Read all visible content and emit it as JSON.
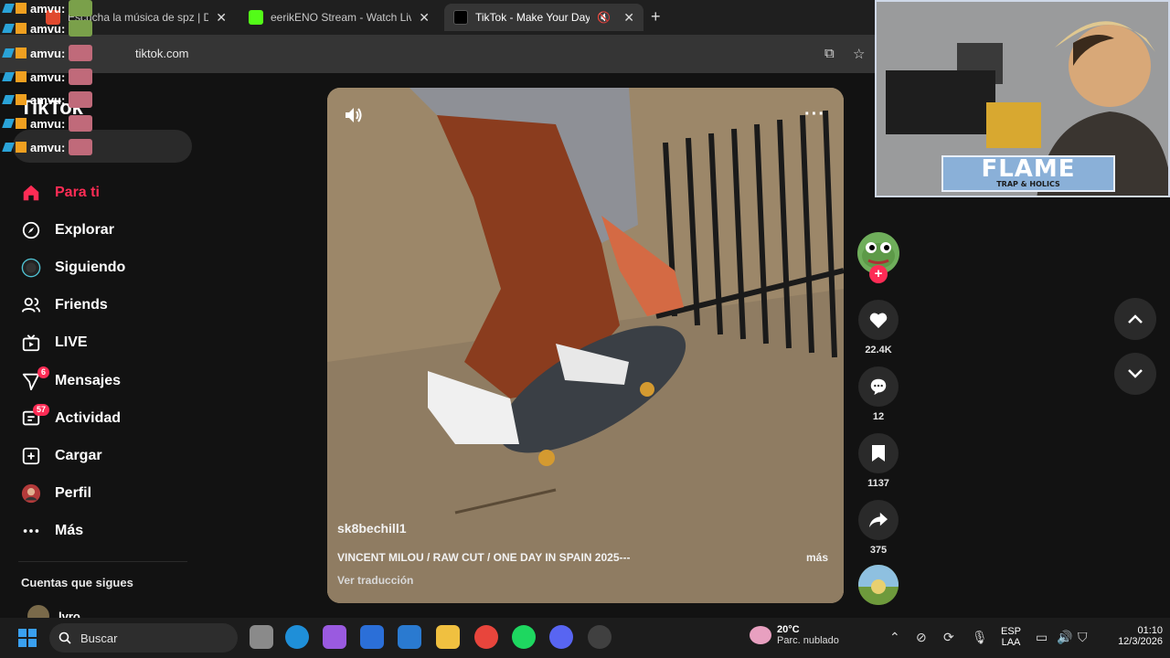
{
  "browser": {
    "tabs": [
      {
        "title": "Escucha la música de spz | Disfr",
        "active": false
      },
      {
        "title": "eerikENO Stream - Watch Live o",
        "active": false
      },
      {
        "title": "TikTok - Make Your Day",
        "active": true
      }
    ],
    "url": "tiktok.com"
  },
  "sidebar": {
    "logo": "TikTok",
    "nav": [
      {
        "label": "Para ti",
        "icon": "home-icon",
        "badge": ""
      },
      {
        "label": "Explorar",
        "icon": "compass-icon",
        "badge": ""
      },
      {
        "label": "Siguiendo",
        "icon": "following-icon",
        "badge": ""
      },
      {
        "label": "Friends",
        "icon": "friends-icon",
        "badge": ""
      },
      {
        "label": "LIVE",
        "icon": "live-icon",
        "badge": ""
      },
      {
        "label": "Mensajes",
        "icon": "messages-icon",
        "badge": "6"
      },
      {
        "label": "Actividad",
        "icon": "activity-icon",
        "badge": "57"
      },
      {
        "label": "Cargar",
        "icon": "upload-icon",
        "badge": ""
      },
      {
        "label": "Perfil",
        "icon": "profile-icon",
        "badge": ""
      },
      {
        "label": "Más",
        "icon": "more-icon",
        "badge": ""
      }
    ],
    "following_title": "Cuentas que sigues",
    "following": [
      {
        "name": "lvro"
      }
    ]
  },
  "video": {
    "author": "sk8bechill1",
    "description": "VINCENT MILOU / RAW CUT / ONE DAY IN SPAIN 2025---",
    "more_label": "más",
    "translate_label": "Ver traducción"
  },
  "actions": {
    "likes": "22.4K",
    "comments": "12",
    "saves": "1137",
    "shares": "375"
  },
  "overlay": {
    "chat_user": "amvu:",
    "stream_label": "FLAME",
    "stream_sublabel": "TRAP & HOLICS"
  },
  "taskbar": {
    "search_label": "Buscar",
    "weather_temp": "20°C",
    "weather_cond": "Parc. nublado",
    "lang_top": "ESP",
    "lang_bottom": "LAA",
    "time": "01:10",
    "date": "12/3/2026"
  },
  "colors": {
    "accent": "#fe2c55",
    "page_bg": "#121212",
    "taskbar_bg": "#1c1c1c"
  }
}
